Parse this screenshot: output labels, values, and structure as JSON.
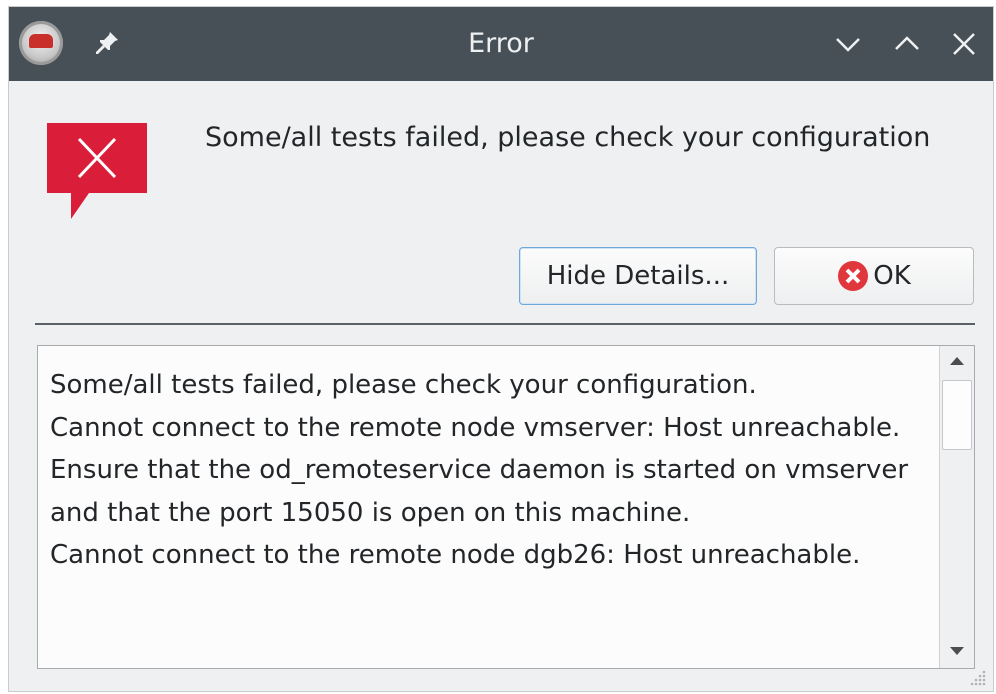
{
  "window": {
    "title": "Error",
    "icons": [
      "app-icon",
      "pin-icon",
      "minimize-icon",
      "maximize-icon",
      "close-icon"
    ]
  },
  "dialog": {
    "message": "Some/all tests failed, please check your configuration",
    "icon": "error-icon",
    "buttons": {
      "details_label": "Hide Details...",
      "ok_label": "OK"
    },
    "details_lines": [
      "Some/all tests failed, please check your configuration.",
      "Cannot connect to the remote node vmserver: Host unreachable.",
      "Ensure that the od_remoteservice daemon is started on vmserver and that the port 15050 is open on this machine.",
      "Cannot connect to the remote node dgb26: Host unreachable."
    ]
  },
  "colors": {
    "titlebar": "#475057",
    "error_red": "#da1e3a",
    "ok_icon_red": "#e0373c",
    "focus_blue": "#6fa7d8"
  }
}
